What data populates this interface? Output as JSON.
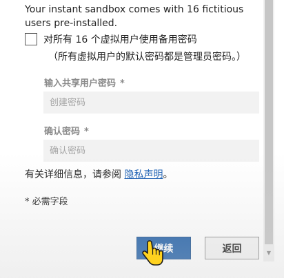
{
  "intro_text": "Your instant sandbox comes with 16 fictitious users pre-installed.",
  "checkbox": {
    "label": "对所有 16 个虚拟用户使用备用密码",
    "note": "（所有虚拟用户的默认密码都是管理员密码。）",
    "checked": false
  },
  "fields": {
    "password": {
      "label": "输入共享用户密码",
      "required_marker": "*",
      "placeholder": "创建密码"
    },
    "confirm": {
      "label": "确认密码",
      "required_marker": "*",
      "placeholder": "确认密码"
    }
  },
  "info": {
    "prefix": "有关详细信息，请参阅 ",
    "link": "隐私声明",
    "suffix": "。"
  },
  "required_note": "* 必需字段",
  "buttons": {
    "continue": "继续",
    "back": "返回"
  },
  "colors": {
    "primary": "#1f5fa8",
    "link": "#1a5fb4",
    "label_disabled": "#8a8a8a"
  },
  "icons": {
    "cursor": "hand-pointer-icon",
    "scroll_down": "scroll-down-arrow-icon"
  }
}
